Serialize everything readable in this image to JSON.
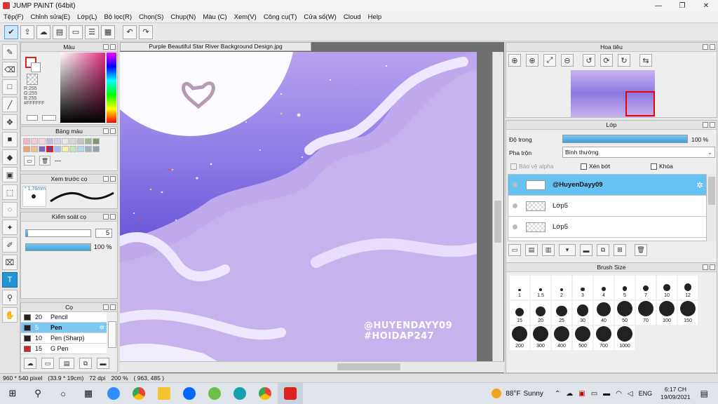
{
  "window": {
    "title": "JUMP PAINT (64bit)",
    "min": "—",
    "max": "❐",
    "close": "✕"
  },
  "menu": [
    "Tệp(F)",
    "Chỉnh sửa(E)",
    "Lớp(L)",
    "Bộ lọc(R)",
    "Chọn(S)",
    "Chụp(N)",
    "Màu (C)",
    "Xem(V)",
    "Công cụ(T)",
    "Cửa sổ(W)",
    "Cloud",
    "Help"
  ],
  "color_panel": {
    "title": "Màu",
    "r": "R:255",
    "g": "G:255",
    "b": "B:255",
    "hex": "#FFFFFF"
  },
  "palette_panel": {
    "title": "Bảng màu",
    "extra": "---"
  },
  "preview_panel": {
    "title": "Xem trước cọ",
    "size": "1.76mm"
  },
  "control_panel": {
    "title": "Kiểm soát cọ",
    "size_value": "5",
    "size_fill": 0.03,
    "opacity_value": "100 %",
    "opacity_fill": 1.0
  },
  "brush_panel": {
    "title": "Cọ",
    "items": [
      {
        "size": "20",
        "name": "Pencil",
        "color": "#222222"
      },
      {
        "size": "5",
        "name": "Pen",
        "color": "#ffffff"
      },
      {
        "size": "10",
        "name": "Pen (Sharp)",
        "color": "#222222"
      },
      {
        "size": "15",
        "name": "G Pen",
        "color": "#dd2222"
      }
    ]
  },
  "canvas": {
    "tab": "Purple Beautiful Star River Background Design.jpg",
    "watermark1": "@HUYENDAYY09",
    "watermark2": "#HOIDAP247"
  },
  "navigator": {
    "title": "Hoa tiêu"
  },
  "layer_panel": {
    "title": "Lớp",
    "opacity_label": "Độ trong",
    "opacity_value": "100 %",
    "opacity_fill": 1.0,
    "blend_label": "Pha trộn",
    "blend_value": "Bình thường",
    "protect_alpha": "Bảo vệ alpha",
    "clip": "Xén bớt",
    "lock": "Khóa",
    "layers": [
      {
        "name": "@HuyenDayy09",
        "selected": true
      },
      {
        "name": "Lớp5",
        "selected": false
      },
      {
        "name": "Lớp5",
        "selected": false
      }
    ]
  },
  "brush_size": {
    "title": "Brush Size",
    "sizes": [
      "1",
      "1.5",
      "2",
      "3",
      "4",
      "5",
      "7",
      "10",
      "12",
      "15",
      "20",
      "25",
      "30",
      "40",
      "50",
      "70",
      "100",
      "150",
      "200",
      "300",
      "400",
      "500",
      "700",
      "1000"
    ]
  },
  "status": {
    "dims": "960 * 540 pixel",
    "cm": "(33.9 * 19cm)",
    "dpi": "72 dpi",
    "zoom": "200 %",
    "coords": "( 963, 485 )"
  },
  "taskbar": {
    "weather_temp": "88°F",
    "weather_desc": "Sunny",
    "lang": "ENG",
    "time": "6:17 CH",
    "date": "19/09/2021"
  }
}
